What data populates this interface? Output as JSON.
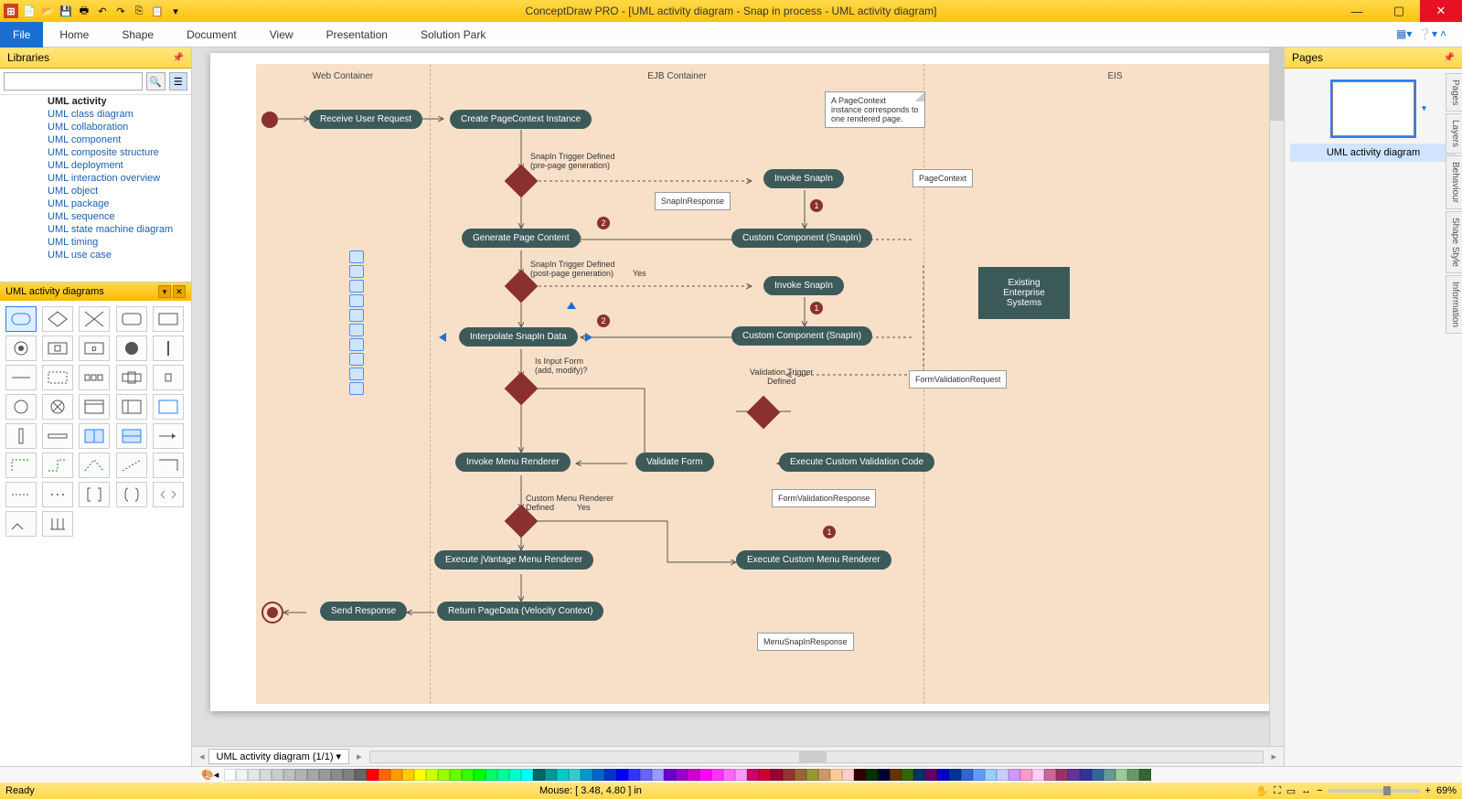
{
  "app_title": "ConceptDraw PRO - [UML activity diagram - Snap in process - UML activity diagram]",
  "ribbon": {
    "file": "File",
    "tabs": [
      "Home",
      "Shape",
      "Document",
      "View",
      "Presentation",
      "Solution Park"
    ]
  },
  "libraries": {
    "title": "Libraries",
    "search_placeholder": "",
    "tree": [
      {
        "label": "UML activity",
        "bold": true
      },
      {
        "label": "UML class diagram"
      },
      {
        "label": "UML collaboration"
      },
      {
        "label": "UML component"
      },
      {
        "label": "UML composite structure"
      },
      {
        "label": "UML deployment"
      },
      {
        "label": "UML interaction overview"
      },
      {
        "label": "UML object"
      },
      {
        "label": "UML package"
      },
      {
        "label": "UML sequence"
      },
      {
        "label": "UML state machine diagram"
      },
      {
        "label": "UML timing"
      },
      {
        "label": "UML use case"
      }
    ],
    "active_lib": "UML activity diagrams"
  },
  "pages_panel": {
    "title": "Pages",
    "thumb_label": "UML activity diagram"
  },
  "side_tabs": [
    "Pages",
    "Layers",
    "Behaviour",
    "Shape Style",
    "Information"
  ],
  "tabbar": {
    "page_tab": "UML activity diagram (1/1)"
  },
  "status": {
    "ready": "Ready",
    "mouse": "Mouse: [ 3.48, 4.80 ] in",
    "zoom": "69%"
  },
  "diagram": {
    "swimlanes": [
      "Web Container",
      "EJB Container",
      "EIS"
    ],
    "activities": {
      "a1": "Receive User Request",
      "a2": "Create PageContext Instance",
      "a3": "Invoke SnapIn",
      "a4": "Custom Component (SnapIn)",
      "a5": "Generate Page Content",
      "a6": "Invoke SnapIn",
      "a7": "Custom Component (SnapIn)",
      "a8": "Interpolate SnapIn Data",
      "a9": "Invoke Menu Renderer",
      "a10": "Validate Form",
      "a11": "Execute Custom Validation Code",
      "a12": "Execute jVantage Menu Renderer",
      "a13": "Execute Custom Menu Renderer",
      "a14": "Send Response",
      "a15": "Return PageData (Velocity Context)",
      "eis": "Existing Enterprise Systems"
    },
    "labels": {
      "l1": "SnapIn Trigger Defined\n(pre-page generation)",
      "l2": "SnapInResponse",
      "l3": "PageContext",
      "l4": "SnapIn Trigger Defined\n(post-page generation)",
      "l5": "Yes",
      "l6": "Is Input Form\n(add, modify)?",
      "l7": "Validation Trigger\nDefined",
      "l8": "FormValidationRequest",
      "l9": "FormValidationResponse",
      "l10": "Custom Menu Renderer\nDefined          Yes",
      "l11": "MenuSnapInResponse",
      "note": "A PageContext instance corresponds to one rendered page."
    }
  },
  "colors": [
    "#ffffff",
    "#f2f2f2",
    "#e6e6e6",
    "#d9d9d9",
    "#cccccc",
    "#bfbfbf",
    "#b3b3b3",
    "#a6a6a6",
    "#999999",
    "#8c8c8c",
    "#808080",
    "#666666",
    "#ff0000",
    "#ff6600",
    "#ff9900",
    "#ffcc00",
    "#ffff00",
    "#ccff00",
    "#99ff00",
    "#66ff00",
    "#33ff00",
    "#00ff00",
    "#00ff66",
    "#00ff99",
    "#00ffcc",
    "#00ffff",
    "#006666",
    "#009999",
    "#00cccc",
    "#33cccc",
    "#0099cc",
    "#0066cc",
    "#0033cc",
    "#0000ff",
    "#3333ff",
    "#6666ff",
    "#9999ff",
    "#6600cc",
    "#9900cc",
    "#cc00cc",
    "#ff00ff",
    "#ff33ff",
    "#ff66ff",
    "#ff99ff",
    "#cc0066",
    "#cc0033",
    "#990033",
    "#993333",
    "#996633",
    "#999933",
    "#cc9966",
    "#ffcc99",
    "#ffcccc",
    "#330000",
    "#003300",
    "#000033",
    "#663300",
    "#336600",
    "#003366",
    "#660066",
    "#0000cc",
    "#003399",
    "#3366cc",
    "#6699ff",
    "#99ccff",
    "#ccccff",
    "#cc99ff",
    "#ff99cc",
    "#ffccff",
    "#cc6699",
    "#993366",
    "#663399",
    "#333399",
    "#336699",
    "#669999",
    "#99cc99",
    "#669966",
    "#336633"
  ]
}
